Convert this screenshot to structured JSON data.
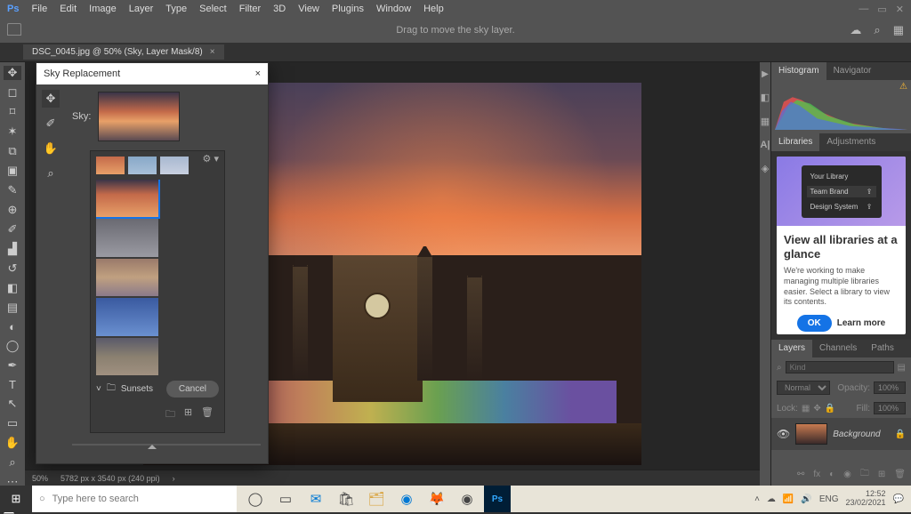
{
  "menu": {
    "items": [
      "File",
      "Edit",
      "Image",
      "Layer",
      "Type",
      "Select",
      "Filter",
      "3D",
      "View",
      "Plugins",
      "Window",
      "Help"
    ]
  },
  "optbar": {
    "hint": "Drag to move the sky layer."
  },
  "tab": {
    "label": "DSC_0045.jpg @ 50% (Sky, Layer Mask/8)"
  },
  "dialog": {
    "title": "Sky Replacement",
    "sky_label": "Sky:",
    "folder": "Sunsets",
    "cancel": "Cancel"
  },
  "panels": {
    "histogram": "Histogram",
    "navigator": "Navigator",
    "libraries": "Libraries",
    "adjustments": "Adjustments",
    "layers": "Layers",
    "channels": "Channels",
    "paths": "Paths"
  },
  "libcard": {
    "your": "Your Library",
    "team": "Team Brand",
    "design": "Design System",
    "title": "View all libraries at a glance",
    "text": "We're working to make managing multiple libraries easier. Select a library to view its contents.",
    "ok": "OK",
    "learn": "Learn more"
  },
  "layers": {
    "kind_ph": "Kind",
    "blend": "Normal",
    "opacity_lbl": "Opacity:",
    "opacity": "100%",
    "lock": "Lock:",
    "fill_lbl": "Fill:",
    "fill": "100%",
    "bg": "Background"
  },
  "status": {
    "zoom": "50%",
    "dims": "5782 px x 3540 px (240 ppi)"
  },
  "taskbar": {
    "search_ph": "Type here to search",
    "lang": "ENG",
    "time": "12:52",
    "date": "23/02/2021"
  }
}
